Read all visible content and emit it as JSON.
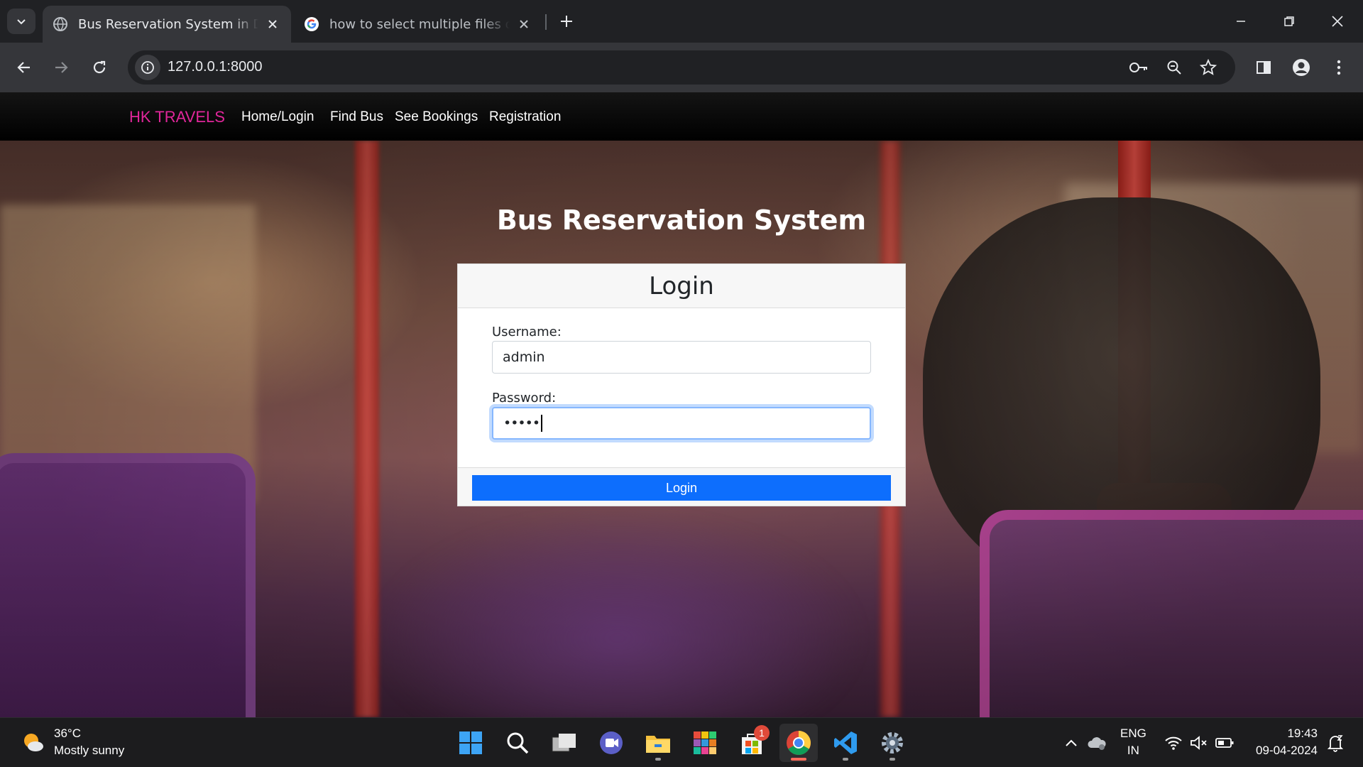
{
  "browser": {
    "tabs": [
      {
        "title": "Bus Reservation System in Djan",
        "favicon": "globe-icon",
        "active": true
      },
      {
        "title": "how to select multiple files on v",
        "favicon": "google-icon",
        "active": false
      }
    ],
    "url": "127.0.0.1:8000"
  },
  "site": {
    "brand": "HK TRAVELS",
    "nav": [
      "Home/Login",
      "Find Bus",
      "See Bookings",
      "Registration"
    ],
    "hero_title": "Bus Reservation System"
  },
  "login": {
    "header": "Login",
    "username_label": "Username:",
    "username_value": "admin",
    "password_label": "Password:",
    "password_masked": "•••••",
    "submit_label": "Login"
  },
  "taskbar": {
    "weather_temp": "36°C",
    "weather_desc": "Mostly sunny",
    "store_badge": "1",
    "lang_top": "ENG",
    "lang_bottom": "IN",
    "time": "19:43",
    "date": "09-04-2024"
  },
  "colors": {
    "brand": "#e0269a",
    "primary_button": "#0d6efd",
    "focus_ring": "#86b7fe"
  }
}
